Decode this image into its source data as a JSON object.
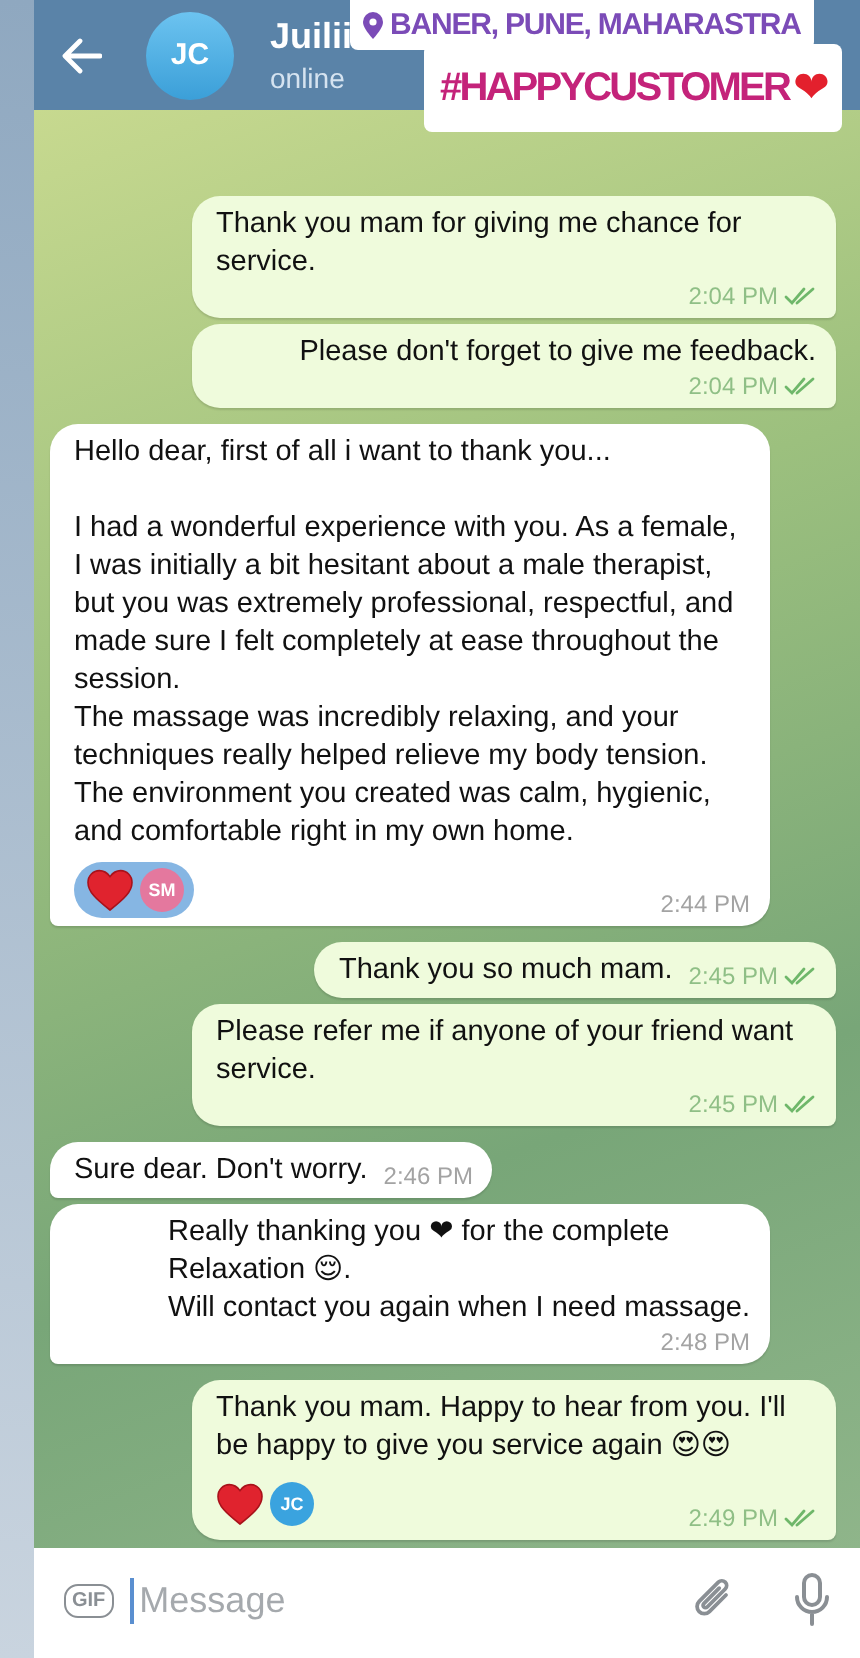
{
  "header": {
    "contact_name": "Juilii",
    "avatar_initials": "JC",
    "status": "online"
  },
  "stickers": {
    "location": "BANER, PUNE, MAHARASTRA",
    "hashtag": "#HAPPYCUSTOMER",
    "hashtag_emoji": "❤"
  },
  "messages": [
    {
      "kind": "outgoing",
      "text": "Thank you mam for giving me chance for service.",
      "time": "2:04 PM",
      "read": true
    },
    {
      "kind": "outgoing",
      "text": "Please don't forget to give me feedback.",
      "time": "2:04 PM",
      "read": true
    },
    {
      "kind": "incoming",
      "text": "Hello dear, first of all i want to thank you...\n\nI had a wonderful experience with you. As a female, I was initially a bit hesitant about a male therapist, but you was extremely professional, respectful, and made sure I felt completely at ease throughout the session.\nThe massage was incredibly relaxing, and your techniques really helped relieve my body tension.\nThe environment you created was calm, hygienic, and comfortable right in my own home.",
      "time": "2:44 PM",
      "read": false,
      "reaction": {
        "chosen": true,
        "initials": "SM",
        "color": "#e4789e"
      }
    },
    {
      "kind": "outgoing",
      "text": "Thank you so much mam.",
      "time": "2:45 PM",
      "read": true
    },
    {
      "kind": "outgoing",
      "text": "Please refer me if anyone of your friend want service.",
      "time": "2:45 PM",
      "read": true
    },
    {
      "kind": "incoming",
      "text": "Sure dear. Don't worry.",
      "time": "2:46 PM",
      "read": false
    },
    {
      "kind": "incoming",
      "text": "Really thanking you ❤ for the complete\nRelaxation 😌.\nWill contact you again when I need massage.",
      "time": "2:48 PM",
      "read": false
    },
    {
      "kind": "outgoing",
      "text": "Thank you mam. Happy to hear from you. I'll be happy to give you service again 😍😍",
      "time": "2:49 PM",
      "read": true,
      "reaction": {
        "chosen": false,
        "initials": "JC",
        "color": "#3aa3df"
      }
    }
  ],
  "composer": {
    "gif_label": "GIF",
    "placeholder": "Message"
  }
}
